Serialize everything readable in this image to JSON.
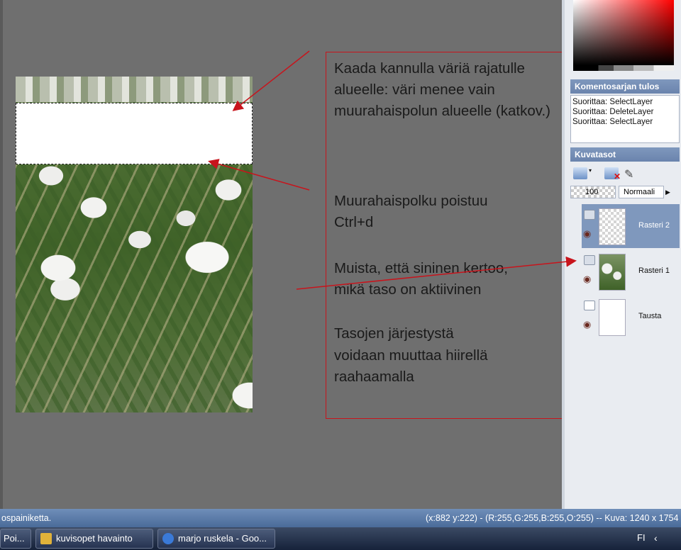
{
  "annotation": {
    "line1": "Kaada kannulla väriä rajatulle",
    "line2": "alueelle: väri menee vain",
    "line3": "muurahaispolun alueelle (katkov.)",
    "line4": "Muurahaispolku poistuu",
    "line5": "Ctrl+d",
    "line6": "Muista, että sininen kertoo,",
    "line7": "mikä  taso on aktiivinen",
    "line8": "Tasojen järjestystä",
    "line9": "voidaan muuttaa hiirellä",
    "line10": "raahaamalla"
  },
  "script_panel": {
    "title": "Komentosarjan tulos",
    "lines": [
      "Suorittaa: SelectLayer",
      "Suorittaa: DeleteLayer",
      "Suorittaa: SelectLayer"
    ]
  },
  "layers_panel": {
    "title": "Kuvatasot",
    "opacity": "100",
    "blend_mode": "Normaali",
    "layers": [
      {
        "name": "Rasteri 2",
        "active": true
      },
      {
        "name": "Rasteri 1",
        "active": false
      },
      {
        "name": "Tausta",
        "active": false
      }
    ]
  },
  "status": {
    "left": "ospainiketta.",
    "right": "(x:882 y:222) - (R:255,G:255,B:255,O:255) -- Kuva:  1240 x 1754 x"
  },
  "taskbar": {
    "tasks": [
      "Poi...",
      "kuvisopet havainto",
      "marjo ruskela - Goo..."
    ],
    "language": "FI"
  },
  "colors": {
    "annotation_border": "#c8141c",
    "active_layer": "#7f98bd",
    "status_bar": "#5a7cab"
  }
}
